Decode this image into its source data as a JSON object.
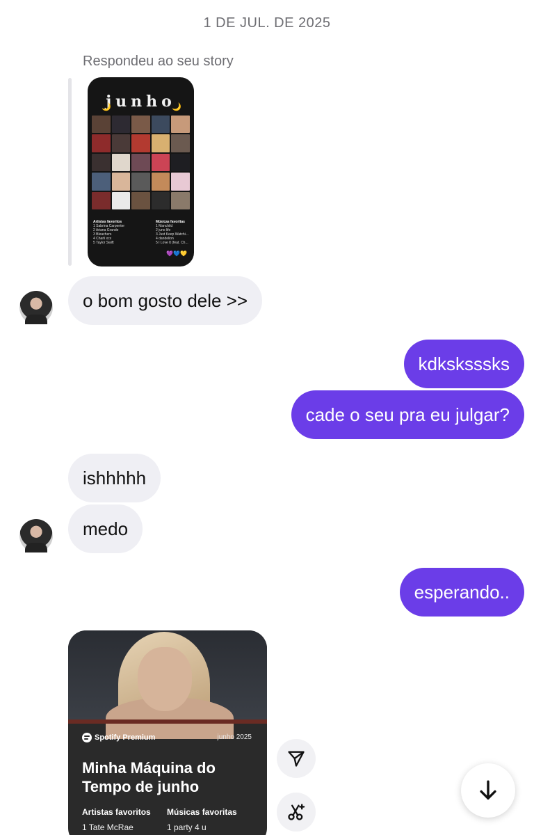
{
  "conversation": {
    "date_separator": "1 DE JUL. DE 2025",
    "story_reply_caption": "Respondeu ao seu story",
    "story_thumbnail": {
      "title": "junho",
      "lists": {
        "artists_head": "Artistas favoritos",
        "artists": [
          "1 Sabrina Carpenter",
          "2 Ariana Grande",
          "3 Bleachers",
          "4 Charli xcx",
          "5 Taylor Swift"
        ],
        "songs_head": "Músicas favoritas",
        "songs": [
          "1 Manchild",
          "2 juno life",
          "3 Just Keep Watchi...",
          "4 dandelion",
          "5 I Love It (feat. Ch..."
        ]
      }
    },
    "messages": [
      {
        "id": "m1",
        "direction": "in",
        "text": "o bom gosto dele >>"
      },
      {
        "id": "m2",
        "direction": "out",
        "text": "kdksksssks"
      },
      {
        "id": "m3",
        "direction": "out",
        "text": "cade o seu pra eu julgar?"
      },
      {
        "id": "m4",
        "direction": "in",
        "text": "ishhhhh"
      },
      {
        "id": "m5",
        "direction": "in",
        "text": "medo"
      },
      {
        "id": "m6",
        "direction": "out",
        "text": "esperando.."
      }
    ],
    "shared_card": {
      "brand": "Spotify Premium",
      "date": "junho 2025",
      "title": "Minha Máquina do Tempo de junho",
      "col1_head": "Artistas favoritos",
      "col1_item": "1 Tate McRae",
      "col2_head": "Músicas favoritas",
      "col2_item": "1 party 4 u"
    },
    "actions": {
      "share_icon": "send-icon",
      "remix_icon": "scissors-sparkle-icon",
      "scroll_icon": "arrow-down-icon"
    },
    "colors": {
      "outgoing_bubble": "#6b3de8",
      "incoming_bubble": "#efeff4",
      "meta_text": "#6e6e73"
    }
  }
}
